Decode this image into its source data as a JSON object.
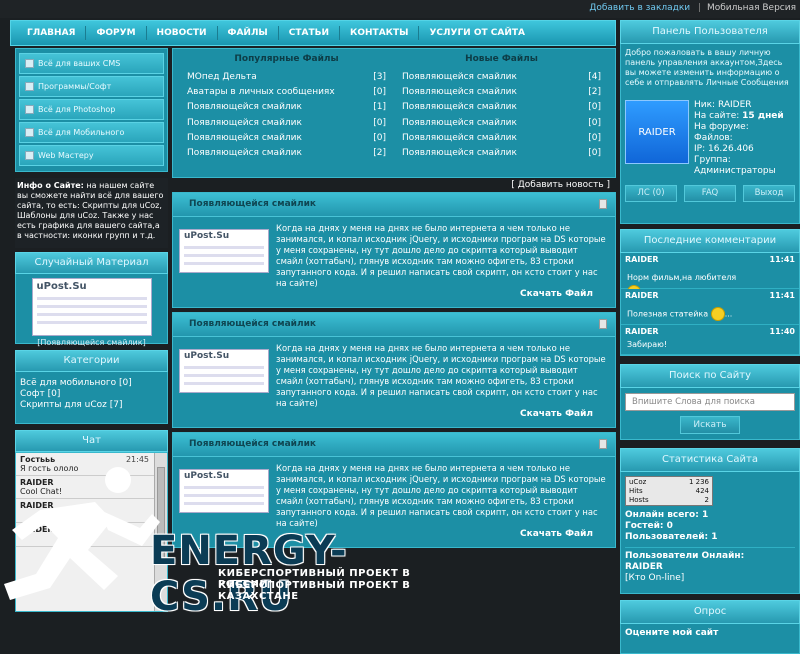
{
  "toplinks": {
    "bookmark": "Добавить в закладки",
    "mobile": "Мобильная Версия"
  },
  "nav": [
    "ГЛАВНАЯ",
    "ФОРУМ",
    "НОВОСТИ",
    "ФАЙЛЫ",
    "СТАТЬИ",
    "КОНТАКТЫ",
    "УСЛУГИ ОТ САЙТА"
  ],
  "categories": [
    "Всё для ваших CMS",
    "Программы/Софт",
    "Всё для Photoshop",
    "Всё для Мобильного",
    "Web Мастеру"
  ],
  "info": {
    "title": "Инфо о Сайте:",
    "text": "на нашем сайте вы сможете найти всё для вашего сайта, то есть: Скрипты для uCoz, Шаблоны для uCoz. Также у нас есть графика для вашего сайта,а в частности: иконки групп и т.д."
  },
  "random": {
    "title": "Случайный Материал",
    "logo": "uPost.Su",
    "caption": "[Появляющейся смайлик]"
  },
  "cats_block": {
    "title": "Категории",
    "items": [
      "Всё для мобильного [0]",
      "Софт [0]",
      "Скрипты для uCoz [7]"
    ]
  },
  "chat": {
    "title": "Чат",
    "messages": [
      {
        "name": "Гостььь",
        "time": "21:45",
        "text": "Я гость ололо"
      },
      {
        "name": "RAIDER",
        "time": "",
        "text": "Cool Chat!"
      },
      {
        "name": "RAIDER",
        "time": "",
        "text": ""
      },
      {
        "name": "RAIDER",
        "time": "",
        "text": ""
      }
    ]
  },
  "popular": {
    "title": "Популярные Файлы",
    "rows": [
      {
        "name": "МОпед Дельта",
        "count": "[3]"
      },
      {
        "name": "Аватары в личных сообщениях",
        "count": "[0]"
      },
      {
        "name": "Появляющейся смайлик",
        "count": "[1]"
      },
      {
        "name": "Появляющейся смайлик",
        "count": "[0]"
      },
      {
        "name": "Появляющейся смайлик",
        "count": "[0]"
      },
      {
        "name": "Появляющейся смайлик",
        "count": "[2]"
      }
    ]
  },
  "newfiles": {
    "title": "Новые Файлы",
    "rows": [
      {
        "name": "Появляющейся смайлик",
        "count": "[4]"
      },
      {
        "name": "Появляющейся смайлик",
        "count": "[2]"
      },
      {
        "name": "Появляющейся смайлик",
        "count": "[0]"
      },
      {
        "name": "Появляющейся смайлик",
        "count": "[0]"
      },
      {
        "name": "Появляющейся смайлик",
        "count": "[0]"
      },
      {
        "name": "Появляющейся смайлик",
        "count": "[0]"
      }
    ]
  },
  "add_news": "[ Добавить новость ]",
  "news": [
    {
      "title": "Появляющейся смайлик",
      "logo": "uPost.Su",
      "text": "Когда на днях у меня на днях не было интернета я чем только не занимался, и копал исходник jQuery, и исходники програм на DS которые у меня сохранены, ну тут дошло дело до скрипта который выводит смайл (хоттабыч), глянув исходник там можно офигеть, 83 строки запутанного кода. И я решил написать свой скрипт, он ксто стоит у нас на сайте)",
      "download": "Скачать Файл"
    },
    {
      "title": "Появляющейся смайлик",
      "logo": "uPost.Su",
      "text": "Когда на днях у меня на днях не было интернета я чем только не занимался, и копал исходник jQuery, и исходники програм на DS которые у меня сохранены, ну тут дошло дело до скрипта который выводит смайл (хоттабыч), глянув исходник там можно офигеть, 83 строки запутанного кода. И я решил написать свой скрипт, он ксто стоит у нас на сайте)",
      "download": "Скачать Файл"
    },
    {
      "title": "Появляющейся смайлик",
      "logo": "uPost.Su",
      "text": "Когда на днях у меня на днях не было интернета я чем только не занимался, и копал исходник jQuery, и исходники програм на DS которые у меня сохранены, ну тут дошло дело до скрипта который выводит смайл (хоттабыч), глянув исходник там можно офигеть, 83 строки запутанного кода. И я решил написать свой скрипт, он ксто стоит у нас на сайте)",
      "download": "Скачать Файл"
    }
  ],
  "user_panel": {
    "title": "Панель Пользователя",
    "welcome": "Добро пожаловать в вашу личную панель управления аккаунтом,Здесь вы можете изменить информацию о себе и отправлять Личные Сообщения",
    "avatar": "RAIDER",
    "nick": "Ник: RAIDER",
    "forum_label": "На сайте:",
    "forum_days": "15 дней",
    "on_forum": "На форуме:",
    "files": "Файлов:",
    "ip": "IP: 16.26.406",
    "group": "Группа:",
    "group_val": "Администраторы",
    "tabs": [
      "ЛС (0)",
      "FAQ",
      "Выход"
    ]
  },
  "comments": {
    "title": "Последние комментарии",
    "items": [
      {
        "name": "RAIDER",
        "time": "11:41",
        "text": "Норм фильм,на любителя",
        "smiley": true
      },
      {
        "name": "RAIDER",
        "time": "11:41",
        "text": "Полезная статейка",
        "smiley": true
      },
      {
        "name": "RAIDER",
        "time": "11:40",
        "text": "Забираю!",
        "smiley": false
      }
    ]
  },
  "search": {
    "title": "Поиск по Сайту",
    "placeholder": "Впишите Слова для поиска",
    "button": "Искать"
  },
  "stats": {
    "title": "Статистика Сайта",
    "counter": [
      {
        "k": "uCoz",
        "v": "1 236"
      },
      {
        "k": "Hits",
        "v": "424"
      },
      {
        "k": "Hosts",
        "v": "2"
      }
    ],
    "online": "Онлайн всего: 1",
    "guests": "Гостей: 0",
    "users": "Пользователей: 1",
    "online_users": "Пользователи Онлайн:",
    "online_name": "RAIDER",
    "who": "[Кто On-line]"
  },
  "poll": {
    "title": "Опрос",
    "question": "Оцените мой сайт"
  },
  "watermark": {
    "word": "ENERGY-CS.RU",
    "sub1": "КИБЕРСПОРТИВНЫЙ ПРОЕКТ В РОССИИ",
    "sub2": "КИБЕРСПОРТИВНЫЙ ПРОЕКТ В КАЗАХСТАНЕ"
  }
}
